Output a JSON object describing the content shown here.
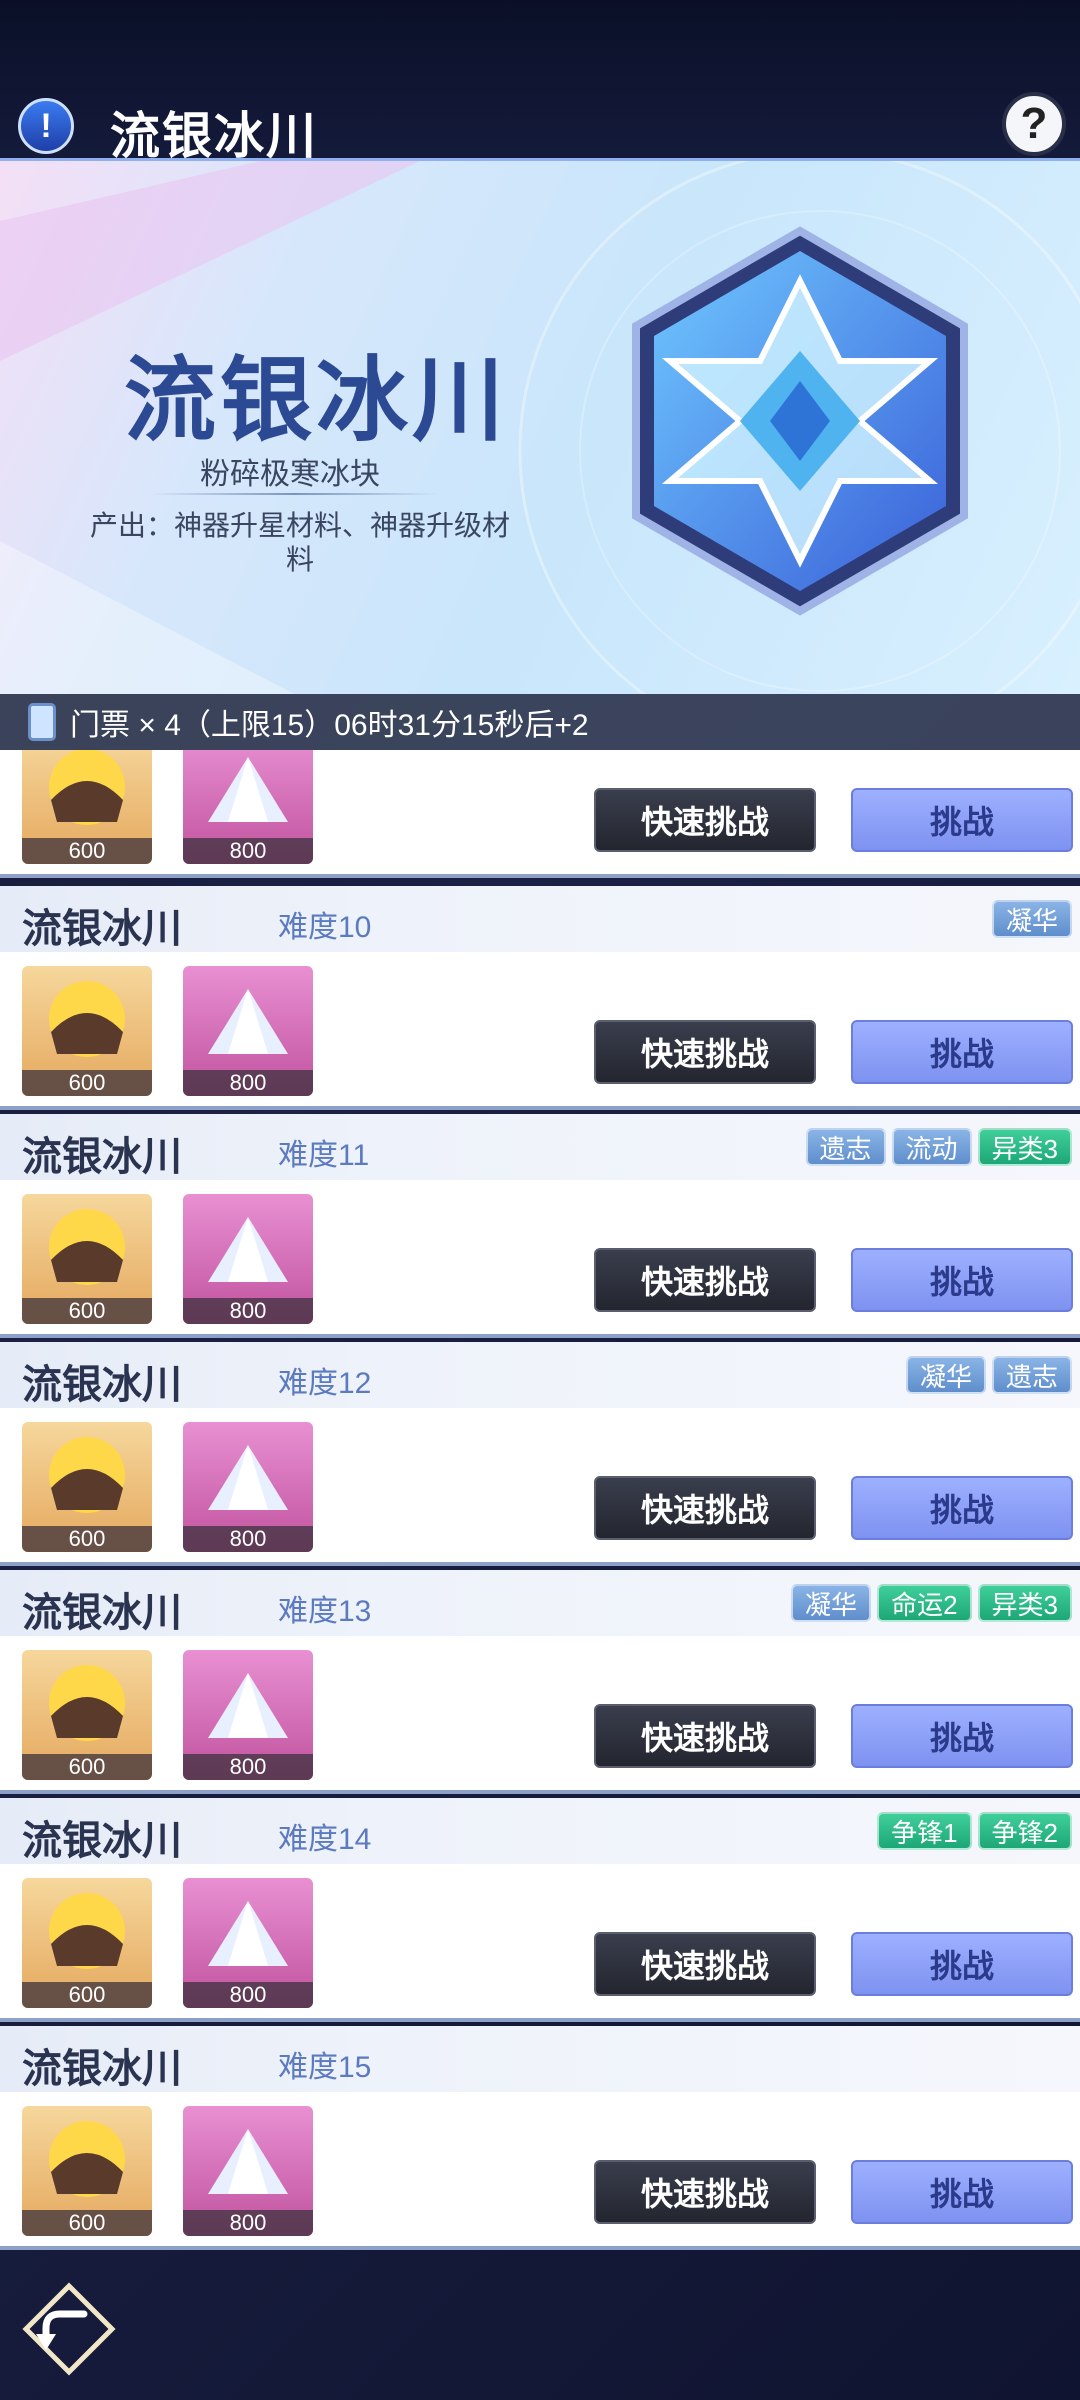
{
  "header": {
    "title": "流银冰川",
    "info_icon": "!",
    "help_icon": "?"
  },
  "banner": {
    "title": "流银冰川",
    "subtitle": "粉碎极寒冰块",
    "output": "产出：神器升星材料、神器升级材料"
  },
  "ticket": {
    "text": "门票 × 4（上限15）06时31分15秒后+2"
  },
  "buttons": {
    "quick": "快速挑战",
    "challenge": "挑战"
  },
  "rewards": {
    "gold_count": "600",
    "crystal_count": "800"
  },
  "stages": [
    {
      "title": "",
      "difficulty": "",
      "tags": []
    },
    {
      "title": "流银冰川",
      "difficulty": "难度10",
      "tags": [
        {
          "label": "凝华",
          "color": "blue"
        }
      ]
    },
    {
      "title": "流银冰川",
      "difficulty": "难度11",
      "tags": [
        {
          "label": "遗志",
          "color": "blue"
        },
        {
          "label": "流动",
          "color": "blue"
        },
        {
          "label": "异类3",
          "color": "green"
        }
      ]
    },
    {
      "title": "流银冰川",
      "difficulty": "难度12",
      "tags": [
        {
          "label": "凝华",
          "color": "blue"
        },
        {
          "label": "遗志",
          "color": "blue"
        }
      ]
    },
    {
      "title": "流银冰川",
      "difficulty": "难度13",
      "tags": [
        {
          "label": "凝华",
          "color": "blue"
        },
        {
          "label": "命运2",
          "color": "green"
        },
        {
          "label": "异类3",
          "color": "green"
        }
      ]
    },
    {
      "title": "流银冰川",
      "difficulty": "难度14",
      "tags": [
        {
          "label": "争锋1",
          "color": "green"
        },
        {
          "label": "争锋2",
          "color": "green"
        }
      ]
    },
    {
      "title": "流银冰川",
      "difficulty": "难度15",
      "tags": []
    }
  ],
  "colors": {
    "accent": "#7e92f0",
    "tag_blue": "#6f9bd6",
    "tag_green": "#22b07f",
    "dark_button": "#2a2d38"
  }
}
